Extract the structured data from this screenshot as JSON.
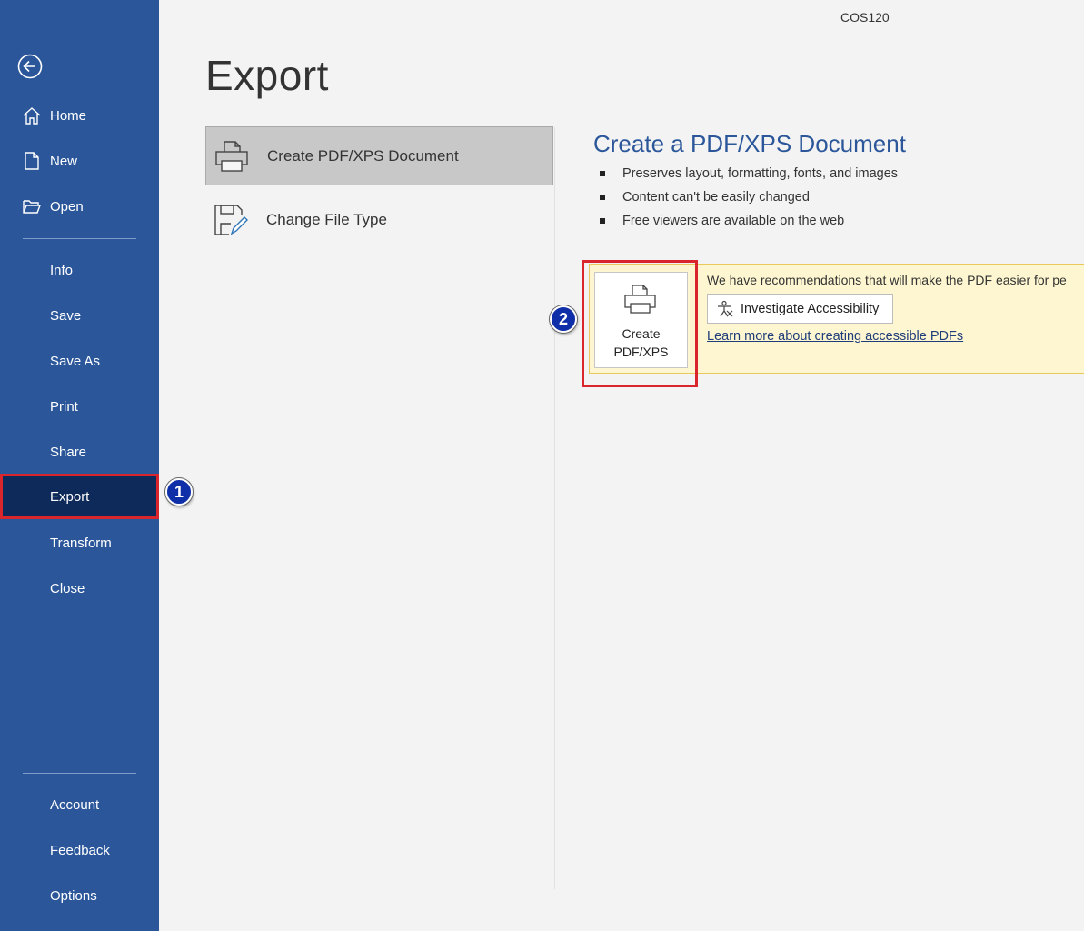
{
  "document_name": "COS120",
  "page_title": "Export",
  "sidebar": {
    "back_icon": "back-arrow-icon",
    "top_items": [
      {
        "label": "Home",
        "icon": "home-icon"
      },
      {
        "label": "New",
        "icon": "new-document-icon"
      },
      {
        "label": "Open",
        "icon": "folder-open-icon"
      }
    ],
    "middle_items": [
      {
        "label": "Info"
      },
      {
        "label": "Save"
      },
      {
        "label": "Save As"
      },
      {
        "label": "Print"
      },
      {
        "label": "Share"
      },
      {
        "label": "Export",
        "active": true
      },
      {
        "label": "Transform"
      },
      {
        "label": "Close"
      }
    ],
    "bottom_items": [
      {
        "label": "Account"
      },
      {
        "label": "Feedback"
      },
      {
        "label": "Options"
      }
    ]
  },
  "export_options": [
    {
      "label": "Create PDF/XPS Document",
      "icon": "printer-document-icon",
      "selected": true
    },
    {
      "label": "Change File Type",
      "icon": "save-edit-icon",
      "selected": false
    }
  ],
  "detail": {
    "title": "Create a PDF/XPS Document",
    "bullets": [
      "Preserves layout, formatting, fonts, and images",
      "Content can't be easily changed",
      "Free viewers are available on the web"
    ],
    "create_button_line1": "Create",
    "create_button_line2": "PDF/XPS",
    "banner_text": "We have recommendations that will make the PDF easier for pe",
    "accessibility_button": "Investigate Accessibility",
    "learn_more_link": "Learn more about creating accessible PDFs"
  },
  "callouts": [
    "1",
    "2"
  ],
  "colors": {
    "sidebar": "#2b579a",
    "sidebar_active": "#0e2a5a",
    "highlight": "#d9262c",
    "callout": "#0f2fa8",
    "banner": "#fdf6d0",
    "title_blue": "#2b579a"
  }
}
